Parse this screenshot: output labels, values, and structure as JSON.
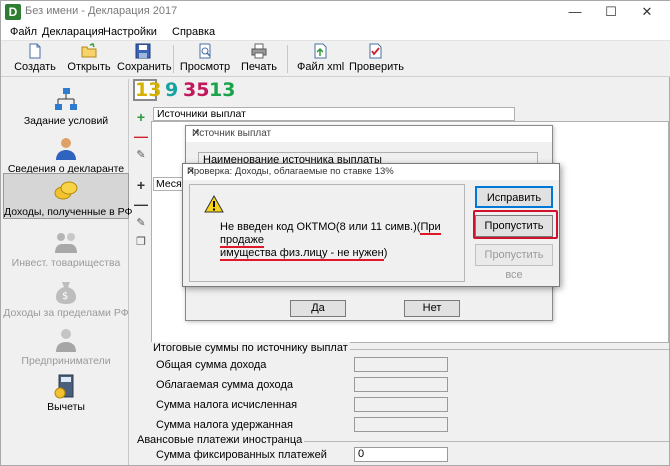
{
  "window": {
    "title": "Без имени - Декларация 2017",
    "app_icon_letter": "D"
  },
  "menu": [
    "Файл",
    "Декларация",
    "Настройки",
    "Справка"
  ],
  "toolbar": {
    "create": "Создать",
    "open": "Открыть",
    "save": "Сохранить",
    "preview": "Просмотр",
    "print": "Печать",
    "xml": "Файл xml",
    "check": "Проверить"
  },
  "sidebar": {
    "items": [
      {
        "label": "Задание условий"
      },
      {
        "label": "Сведения о декларанте"
      },
      {
        "label": "Доходы, полученные в РФ"
      },
      {
        "label": "Инвест. товарищества"
      },
      {
        "label": "Доходы за пределами РФ"
      },
      {
        "label": "Предприниматели"
      },
      {
        "label": "Вычеты"
      }
    ]
  },
  "rates": {
    "r13": "13",
    "r9": "9",
    "r35": "35",
    "r13b": "13"
  },
  "sources_header": "Источники выплат",
  "months_header": "Месяц",
  "totals": {
    "title": "Итоговые суммы по источнику выплат",
    "rows": [
      "Общая сумма дохода",
      "Облагаемая сумма дохода",
      "Сумма налога исчисленная",
      "Сумма налога удержанная"
    ]
  },
  "advance": {
    "title": "Авансовые платежи иностранца",
    "label": "Сумма фиксированных платежей",
    "value": "0"
  },
  "source_dialog": {
    "title": "Источник выплат",
    "field": "Наименование источника выплаты",
    "yes": "Да",
    "no": "Нет"
  },
  "alert": {
    "title": "Проверка: Доходы, облагаемые по ставке 13%",
    "message_start": "Не введен код ОКТМО(8 или 11 симв.)(",
    "message_underlined_1": "При продаже",
    "message_underlined_2": "имущества физ.лицу - не нужен",
    "message_end": ")",
    "fix": "Исправить",
    "skip": "Пропустить",
    "skip_all": "Пропустить все"
  }
}
